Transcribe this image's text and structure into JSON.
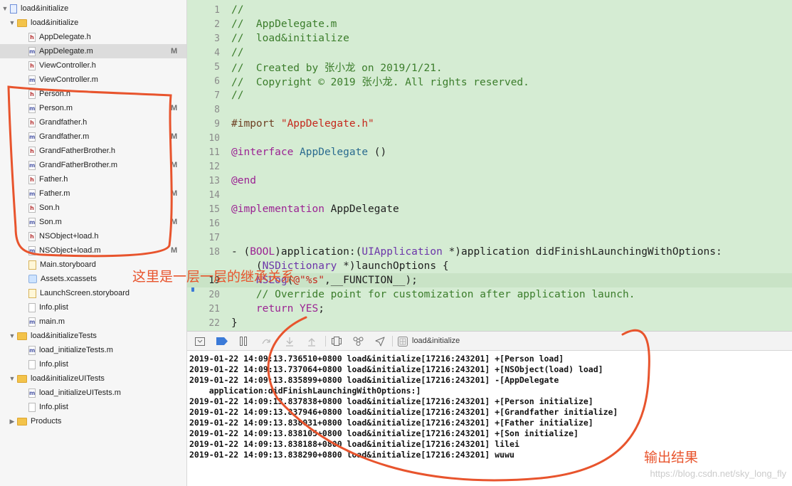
{
  "navigator": {
    "rows": [
      {
        "label": "load&initialize",
        "kind": "project",
        "disclosure": "open",
        "badge": ""
      },
      {
        "label": "load&initialize",
        "kind": "folder",
        "disclosure": "open",
        "badge": ""
      },
      {
        "label": "AppDelegate.h",
        "kind": "h",
        "disclosure": "",
        "badge": ""
      },
      {
        "label": "AppDelegate.m",
        "kind": "m",
        "disclosure": "",
        "badge": "M",
        "selected": true
      },
      {
        "label": "ViewController.h",
        "kind": "h",
        "disclosure": "",
        "badge": ""
      },
      {
        "label": "ViewController.m",
        "kind": "m",
        "disclosure": "",
        "badge": ""
      },
      {
        "label": "Person.h",
        "kind": "h",
        "disclosure": "",
        "badge": ""
      },
      {
        "label": "Person.m",
        "kind": "m",
        "disclosure": "",
        "badge": "M"
      },
      {
        "label": "Grandfather.h",
        "kind": "h",
        "disclosure": "",
        "badge": ""
      },
      {
        "label": "Grandfather.m",
        "kind": "m",
        "disclosure": "",
        "badge": "M"
      },
      {
        "label": "GrandFatherBrother.h",
        "kind": "h",
        "disclosure": "",
        "badge": ""
      },
      {
        "label": "GrandFatherBrother.m",
        "kind": "m",
        "disclosure": "",
        "badge": "M"
      },
      {
        "label": "Father.h",
        "kind": "h",
        "disclosure": "",
        "badge": ""
      },
      {
        "label": "Father.m",
        "kind": "m",
        "disclosure": "",
        "badge": "M"
      },
      {
        "label": "Son.h",
        "kind": "h",
        "disclosure": "",
        "badge": ""
      },
      {
        "label": "Son.m",
        "kind": "m",
        "disclosure": "",
        "badge": "M"
      },
      {
        "label": "NSObject+load.h",
        "kind": "h",
        "disclosure": "",
        "badge": ""
      },
      {
        "label": "NSObject+load.m",
        "kind": "m",
        "disclosure": "",
        "badge": "M"
      },
      {
        "label": "Main.storyboard",
        "kind": "storyboard",
        "disclosure": "",
        "badge": ""
      },
      {
        "label": "Assets.xcassets",
        "kind": "assets",
        "disclosure": "",
        "badge": ""
      },
      {
        "label": "LaunchScreen.storyboard",
        "kind": "storyboard",
        "disclosure": "",
        "badge": ""
      },
      {
        "label": "Info.plist",
        "kind": "plain",
        "disclosure": "",
        "badge": ""
      },
      {
        "label": "main.m",
        "kind": "m",
        "disclosure": "",
        "badge": ""
      },
      {
        "label": "load&initializeTests",
        "kind": "folder",
        "disclosure": "open",
        "badge": ""
      },
      {
        "label": "load_initializeTests.m",
        "kind": "m",
        "disclosure": "",
        "badge": ""
      },
      {
        "label": "Info.plist",
        "kind": "plain",
        "disclosure": "",
        "badge": ""
      },
      {
        "label": "load&initializeUITests",
        "kind": "folder",
        "disclosure": "open",
        "badge": ""
      },
      {
        "label": "load_initializeUITests.m",
        "kind": "m",
        "disclosure": "",
        "badge": ""
      },
      {
        "label": "Info.plist",
        "kind": "plain",
        "disclosure": "",
        "badge": ""
      },
      {
        "label": "Products",
        "kind": "folder",
        "disclosure": "closed",
        "badge": ""
      }
    ]
  },
  "editor": {
    "current_line": 19,
    "lines": [
      {
        "n": "1",
        "tokens": [
          {
            "t": "//",
            "c": "comment"
          }
        ]
      },
      {
        "n": "2",
        "tokens": [
          {
            "t": "//  AppDelegate.m",
            "c": "comment"
          }
        ]
      },
      {
        "n": "3",
        "tokens": [
          {
            "t": "//  load&initialize",
            "c": "comment"
          }
        ]
      },
      {
        "n": "4",
        "tokens": [
          {
            "t": "//",
            "c": "comment"
          }
        ]
      },
      {
        "n": "5",
        "tokens": [
          {
            "t": "//  Created by 张小龙 on 2019/1/21.",
            "c": "comment"
          }
        ]
      },
      {
        "n": "6",
        "tokens": [
          {
            "t": "//  Copyright © 2019 张小龙. All rights reserved.",
            "c": "comment"
          }
        ]
      },
      {
        "n": "7",
        "tokens": [
          {
            "t": "//",
            "c": "comment"
          }
        ]
      },
      {
        "n": "8",
        "tokens": []
      },
      {
        "n": "9",
        "tokens": [
          {
            "t": "#import ",
            "c": "directive"
          },
          {
            "t": "\"AppDelegate.h\"",
            "c": "string"
          }
        ]
      },
      {
        "n": "10",
        "tokens": []
      },
      {
        "n": "11",
        "tokens": [
          {
            "t": "@interface",
            "c": "keyword"
          },
          {
            "t": " ",
            "c": "plain"
          },
          {
            "t": "AppDelegate",
            "c": "class"
          },
          {
            "t": " ()",
            "c": "plain"
          }
        ]
      },
      {
        "n": "12",
        "tokens": []
      },
      {
        "n": "13",
        "tokens": [
          {
            "t": "@end",
            "c": "keyword"
          }
        ]
      },
      {
        "n": "14",
        "tokens": []
      },
      {
        "n": "15",
        "tokens": [
          {
            "t": "@implementation",
            "c": "keyword"
          },
          {
            "t": " AppDelegate",
            "c": "plain"
          }
        ]
      },
      {
        "n": "16",
        "tokens": []
      },
      {
        "n": "17",
        "tokens": []
      },
      {
        "n": "18",
        "tokens": [
          {
            "t": "- (",
            "c": "plain"
          },
          {
            "t": "BOOL",
            "c": "keyword"
          },
          {
            "t": ")application:(",
            "c": "plain"
          },
          {
            "t": "UIApplication",
            "c": "type"
          },
          {
            "t": " *)application didFinishLaunchingWithOptions:",
            "c": "plain"
          }
        ]
      },
      {
        "n": "",
        "tokens": [
          {
            "t": "    (",
            "c": "plain"
          },
          {
            "t": "NSDictionary",
            "c": "type"
          },
          {
            "t": " *)launchOptions {",
            "c": "plain"
          }
        ]
      },
      {
        "n": "19",
        "tokens": [
          {
            "t": "    ",
            "c": "plain"
          },
          {
            "t": "NSLog",
            "c": "type"
          },
          {
            "t": "(",
            "c": "plain"
          },
          {
            "t": "@\"%s\"",
            "c": "string"
          },
          {
            "t": ",__FUNCTION__);",
            "c": "plain"
          }
        ]
      },
      {
        "n": "20",
        "tokens": [
          {
            "t": "    // Override point for customization after application launch.",
            "c": "comment"
          }
        ]
      },
      {
        "n": "21",
        "tokens": [
          {
            "t": "    ",
            "c": "plain"
          },
          {
            "t": "return",
            "c": "keyword"
          },
          {
            "t": " ",
            "c": "plain"
          },
          {
            "t": "YES",
            "c": "keyword"
          },
          {
            "t": ";",
            "c": "plain"
          }
        ]
      },
      {
        "n": "22",
        "tokens": [
          {
            "t": "}",
            "c": "plain"
          }
        ]
      }
    ]
  },
  "debug_bar": {
    "scheme": "load&initialize"
  },
  "console": {
    "lines": [
      "2019-01-22 14:09:13.736510+0800 load&initialize[17216:243201] +[Person load]",
      "2019-01-22 14:09:13.737064+0800 load&initialize[17216:243201] +[NSObject(load) load]",
      "2019-01-22 14:09:13.835899+0800 load&initialize[17216:243201] -[AppDelegate",
      "    application:didFinishLaunchingWithOptions:]",
      "2019-01-22 14:09:13.837838+0800 load&initialize[17216:243201] +[Person initialize]",
      "2019-01-22 14:09:13.837946+0800 load&initialize[17216:243201] +[Grandfather initialize]",
      "2019-01-22 14:09:13.838031+0800 load&initialize[17216:243201] +[Father initialize]",
      "2019-01-22 14:09:13.838105+0800 load&initialize[17216:243201] +[Son initialize]",
      "2019-01-22 14:09:13.838188+0800 load&initialize[17216:243201] lilei",
      "2019-01-22 14:09:13.838290+0800 load&initialize[17216:243201] wuwu"
    ]
  },
  "annotations": {
    "navigator_note": "这里是一层一层的继承关系",
    "console_note": "输出结果",
    "color": "#e8542d"
  },
  "watermark": "https://blog.csdn.net/sky_long_fly"
}
